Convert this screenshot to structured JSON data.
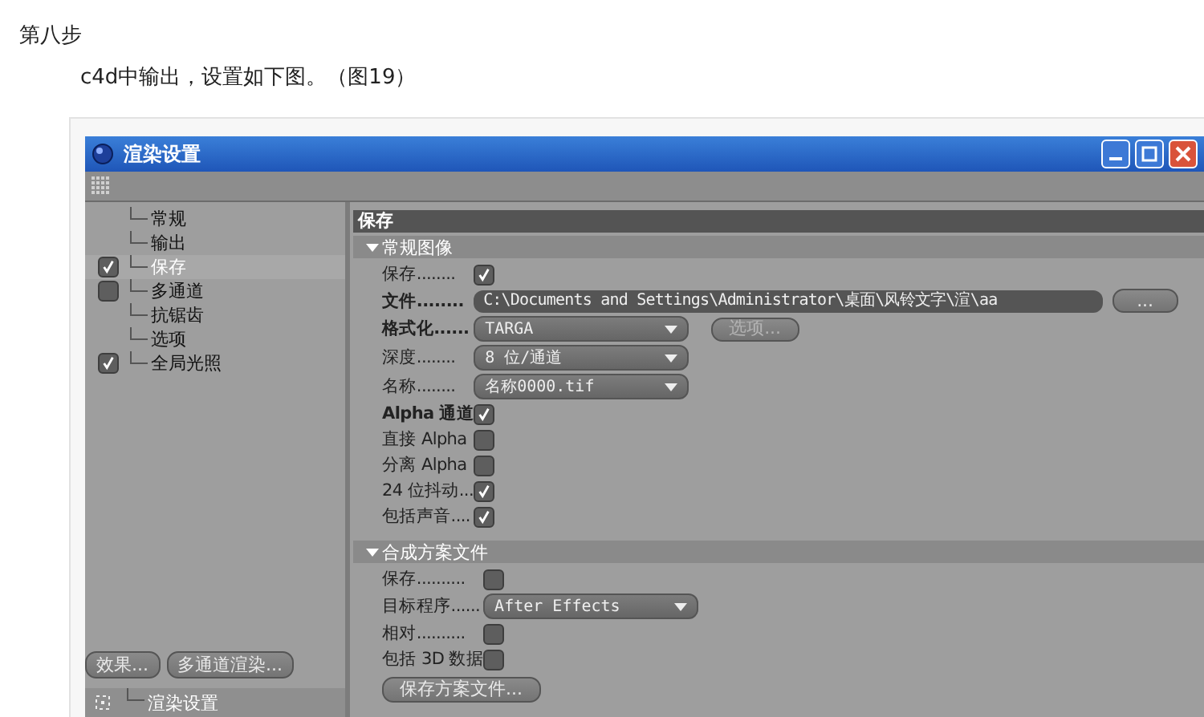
{
  "heading": "第八步",
  "caption": "c4d中输出，设置如下图。（图19）",
  "window": {
    "title": "渲染设置"
  },
  "sidebar": {
    "items": [
      {
        "label": "常规",
        "kind": "plain",
        "selected": false
      },
      {
        "label": "输出",
        "kind": "plain",
        "selected": false
      },
      {
        "label": "保存",
        "kind": "checkbox",
        "checked": true,
        "selected": true
      },
      {
        "label": "多通道",
        "kind": "checkbox",
        "checked": false,
        "selected": false
      },
      {
        "label": "抗锯齿",
        "kind": "plain",
        "selected": false
      },
      {
        "label": "选项",
        "kind": "plain",
        "selected": false
      },
      {
        "label": "全局光照",
        "kind": "checkbox",
        "checked": true,
        "selected": false
      }
    ],
    "buttons": [
      "效果...",
      "多通道渲染..."
    ],
    "status": "渲染设置"
  },
  "panel": {
    "title": "保存",
    "sections": [
      {
        "title": "常规图像",
        "expanded": true,
        "rows": [
          {
            "kind": "checkbox",
            "label": "保存........",
            "bold": false,
            "checked": true
          },
          {
            "kind": "path",
            "label": "文件........",
            "bold": true,
            "value": "C:\\Documents and Settings\\Administrator\\桌面\\风铃文字\\渲\\aa",
            "button": "..."
          },
          {
            "kind": "dropdown",
            "label": "格式化......",
            "bold": true,
            "value": "TARGA",
            "button": "选项...",
            "button_disabled": true
          },
          {
            "kind": "dropdown",
            "label": "深度........",
            "bold": false,
            "value": "8 位/通道"
          },
          {
            "kind": "dropdown",
            "label": "名称........",
            "bold": false,
            "value": "名称0000.tif"
          },
          {
            "kind": "checkbox",
            "label": "Alpha 通道",
            "bold": true,
            "checked": true
          },
          {
            "kind": "checkbox",
            "label": "直接 Alpha",
            "bold": false,
            "checked": false
          },
          {
            "kind": "checkbox",
            "label": "分离 Alpha",
            "bold": false,
            "checked": false
          },
          {
            "kind": "checkbox",
            "label": "24 位抖动...",
            "bold": false,
            "checked": true
          },
          {
            "kind": "checkbox",
            "label": "包括声音....",
            "bold": false,
            "checked": true
          }
        ]
      },
      {
        "title": "合成方案文件",
        "expanded": true,
        "rows": [
          {
            "kind": "checkbox",
            "label": "保存..........",
            "bold": false,
            "checked": false
          },
          {
            "kind": "dropdown",
            "label": "目标程序......",
            "bold": false,
            "value": "After Effects"
          },
          {
            "kind": "checkbox",
            "label": "相对..........",
            "bold": false,
            "checked": false
          },
          {
            "kind": "checkbox",
            "label": "包括 3D 数据",
            "bold": false,
            "checked": false
          },
          {
            "kind": "button",
            "label": "保存方案文件..."
          }
        ]
      }
    ]
  }
}
